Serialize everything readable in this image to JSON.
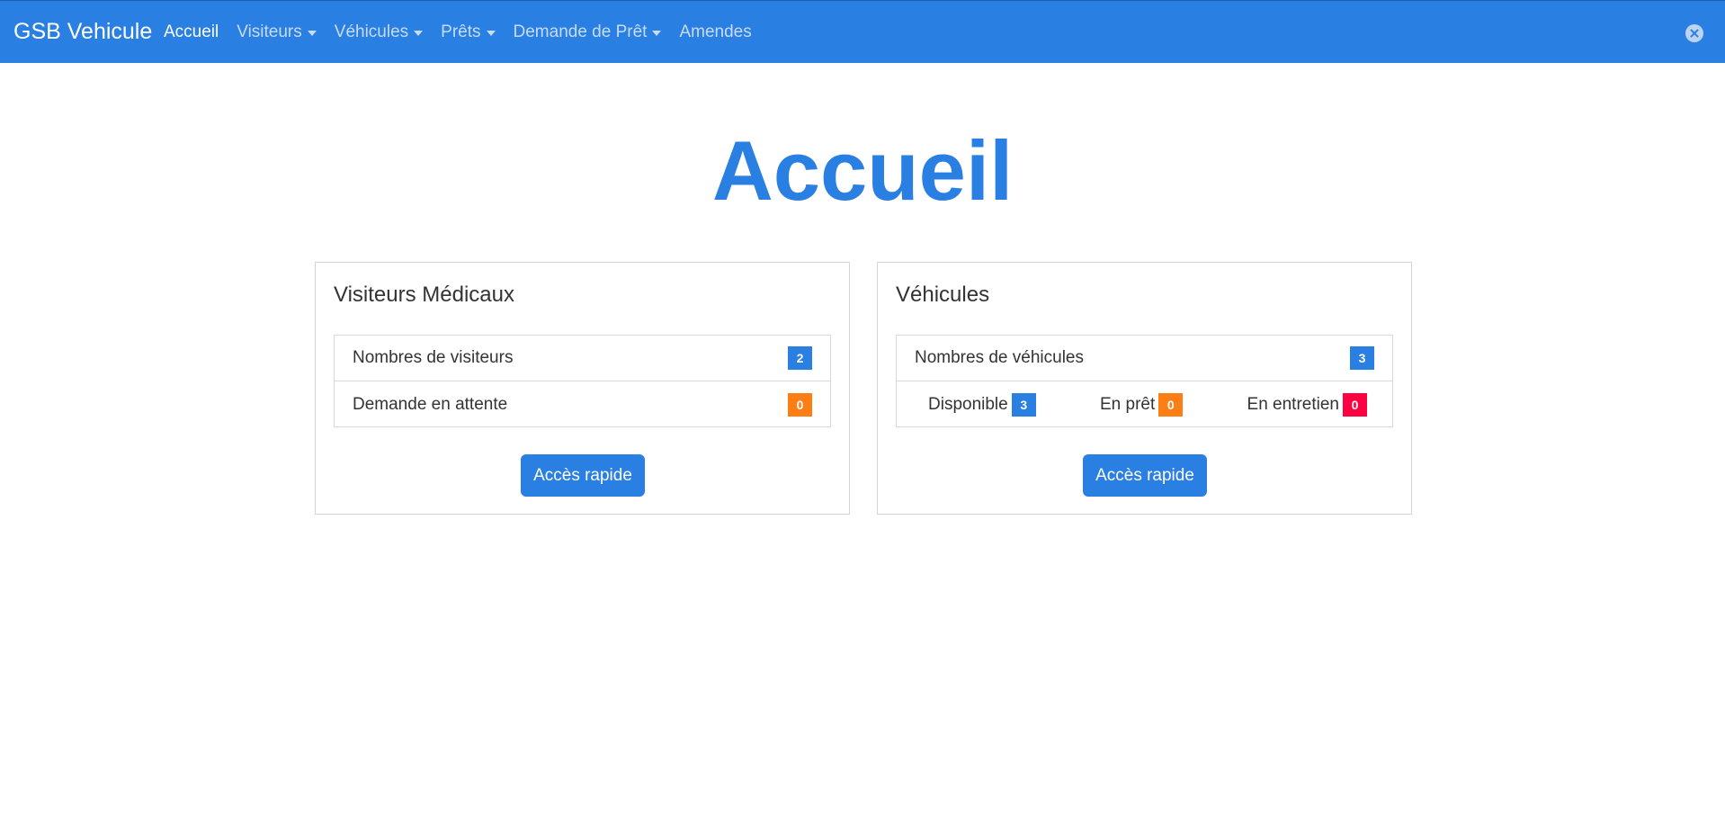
{
  "navbar": {
    "brand": "GSB Vehicule",
    "items": [
      {
        "label": "Accueil",
        "dropdown": false,
        "active": true
      },
      {
        "label": "Visiteurs",
        "dropdown": true,
        "active": false
      },
      {
        "label": "Véhicules",
        "dropdown": true,
        "active": false
      },
      {
        "label": "Prêts",
        "dropdown": true,
        "active": false
      },
      {
        "label": "Demande de Prêt",
        "dropdown": true,
        "active": false
      },
      {
        "label": "Amendes",
        "dropdown": false,
        "active": false
      }
    ],
    "close_icon": "close-circle-icon"
  },
  "main": {
    "title": "Accueil"
  },
  "visiteurs_card": {
    "title": "Visiteurs Médicaux",
    "rows": [
      {
        "label": "Nombres de visiteurs",
        "count": "2",
        "color": "#2a7fe3"
      },
      {
        "label": "Demande en attente",
        "count": "0",
        "color": "#fd7e14"
      }
    ],
    "button_label": "Accès rapide"
  },
  "vehicules_card": {
    "title": "Véhicules",
    "total": {
      "label": "Nombres de véhicules",
      "count": "3",
      "color": "#2a7fe3"
    },
    "statuses": [
      {
        "label": "Disponible",
        "count": "3",
        "color": "#2a7fe3"
      },
      {
        "label": "En prêt",
        "count": "0",
        "color": "#fd7e14"
      },
      {
        "label": "En entretien",
        "count": "0",
        "color": "#ff0040"
      }
    ],
    "button_label": "Accès rapide"
  },
  "colors": {
    "primary": "#2a7fe3",
    "warning": "#fd7e14",
    "danger": "#ff0040"
  }
}
